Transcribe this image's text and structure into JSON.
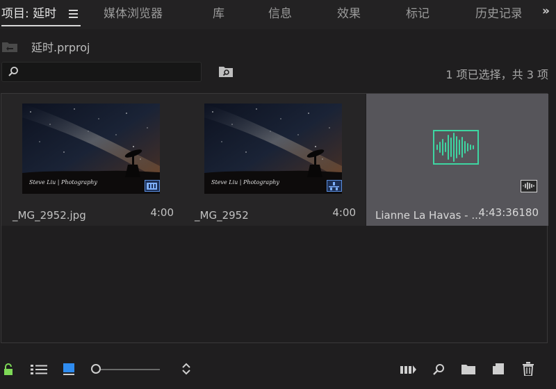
{
  "tabs": {
    "active": "项目: 延时",
    "items": [
      "媒体浏览器",
      "库",
      "信息",
      "效果",
      "标记",
      "历史记录"
    ]
  },
  "project": {
    "name": "延时.prproj"
  },
  "search": {
    "placeholder": "",
    "value": ""
  },
  "selection_status": "1 项已选择，共 3 项",
  "items": [
    {
      "name": "_MG_2952.jpg",
      "duration": "4:00",
      "type": "still-image",
      "badge_icon": "film-strip-icon"
    },
    {
      "name": "_MG_2952",
      "duration": "4:00",
      "type": "sequence",
      "badge_icon": "sequence-icon"
    },
    {
      "name": "Lianne La Havas - ...",
      "duration": "4:43:36180",
      "type": "audio",
      "badge_icon": "audio-waveform-icon",
      "selected": true
    }
  ],
  "thumbnail_watermark": "Steve Liu | Photography",
  "zoom_level": 0.05,
  "colors": {
    "accent": "#5a8fe0",
    "audio": "#3ed6a2",
    "lock": "#7ed957"
  }
}
